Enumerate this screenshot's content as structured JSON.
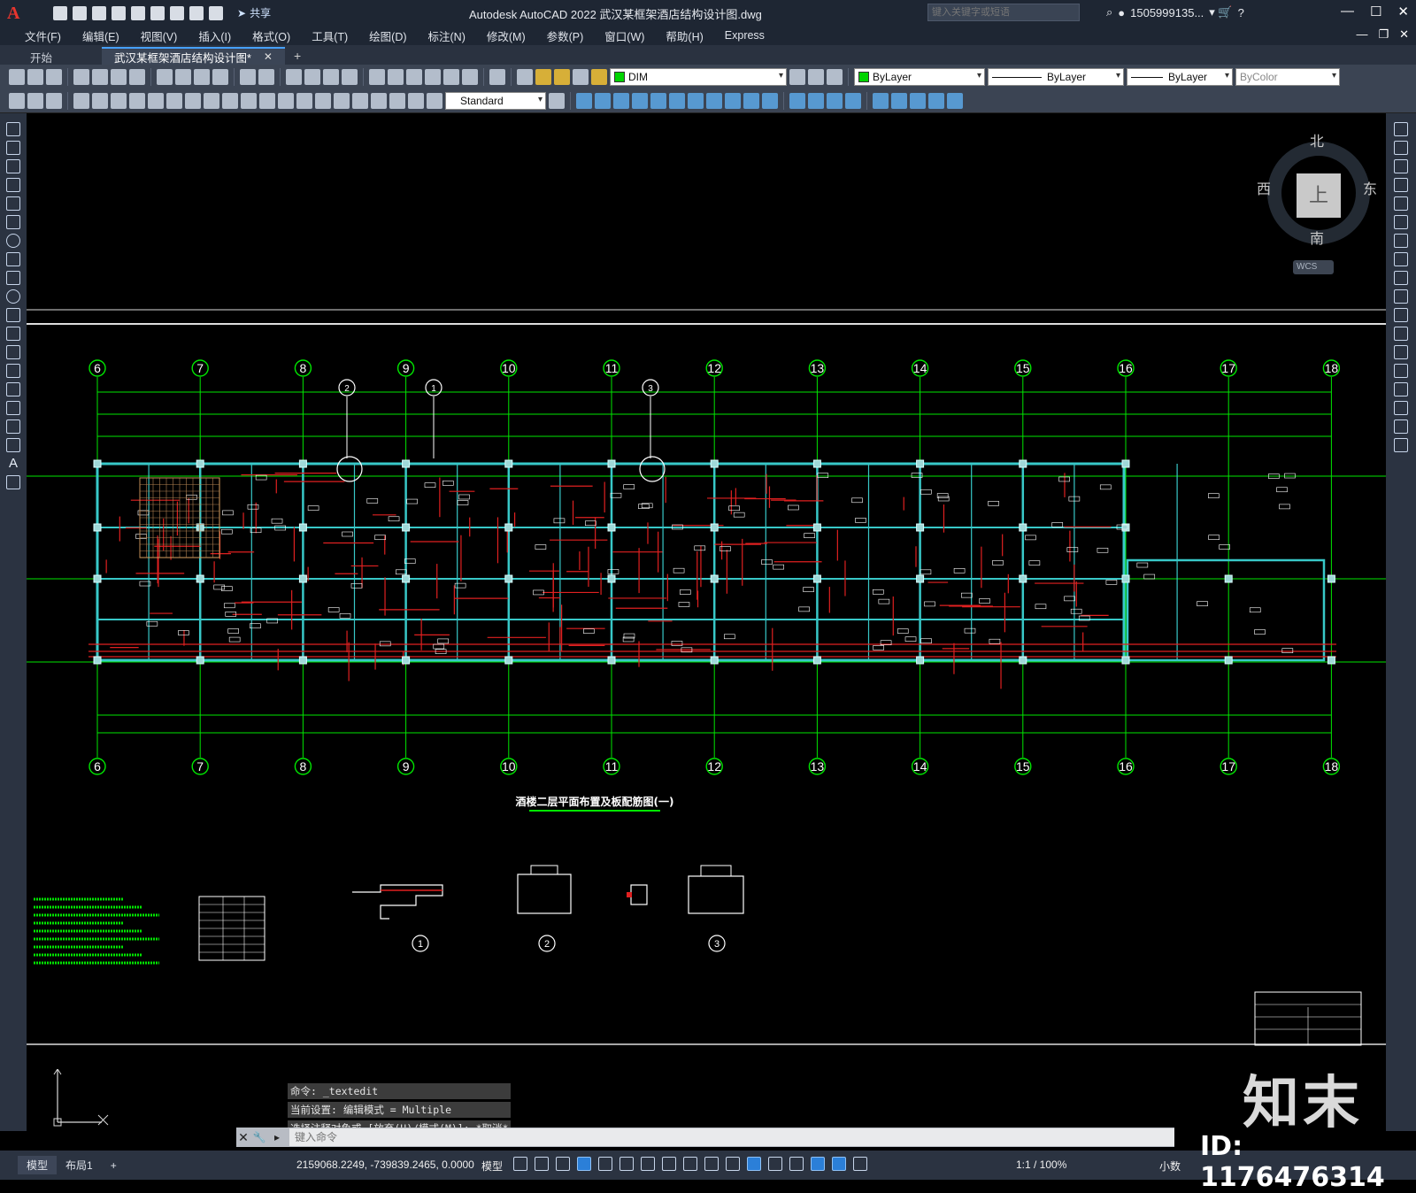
{
  "app": {
    "logo": "A",
    "title": "Autodesk AutoCAD 2022    武汉某框架酒店结构设计图.dwg",
    "share_label": "共享",
    "search_placeholder": "键入关键字或短语",
    "user": "1505999135...",
    "window_controls": [
      "—",
      "☐",
      "✕"
    ]
  },
  "menu": [
    "文件(F)",
    "编辑(E)",
    "视图(V)",
    "插入(I)",
    "格式(O)",
    "工具(T)",
    "绘图(D)",
    "标注(N)",
    "修改(M)",
    "参数(P)",
    "窗口(W)",
    "帮助(H)",
    "Express"
  ],
  "tabs": {
    "start": "开始",
    "active": "武汉某框架酒店结构设计图*",
    "close": "✕",
    "add": "+"
  },
  "toolbar": {
    "layer": "DIM",
    "color": "ByLayer",
    "linetype": "ByLayer",
    "lineweight": "ByLayer",
    "plotstyle": "ByColor",
    "textstyle": "Standard",
    "layer_color": "#00d400"
  },
  "viewcube": {
    "north": "北",
    "south": "南",
    "west": "西",
    "east": "东",
    "top": "上",
    "wcs": "WCS"
  },
  "drawing": {
    "grid_labels": [
      "6",
      "7",
      "8",
      "9",
      "10",
      "11",
      "12",
      "13",
      "14",
      "15",
      "16",
      "17",
      "18"
    ],
    "section_markers": [
      "2",
      "1",
      "3"
    ],
    "plan_title": "酒楼二层平面布置及板配筋图(一)",
    "detail_labels": [
      "1",
      "2",
      "3"
    ],
    "colors": {
      "grid": "#00e600",
      "beam": "#e02020",
      "column": "#7fd0d0",
      "text": "#ffffff",
      "cyan": "#38c8c8"
    }
  },
  "command": {
    "history": [
      "命令: _textedit",
      "当前设置: 编辑模式 = Multiple",
      "选择注释对象或 [放弃(U)/模式(M)]: *取消*"
    ],
    "placeholder": "键入命令"
  },
  "status": {
    "model_tab": "模型",
    "layout_tab": "布局1",
    "add": "+",
    "coordinates": "2159068.2249, -739839.2465, 0.0000",
    "model_label": "模型",
    "scale": "1:1 / 100%",
    "units": "小数"
  },
  "watermark": {
    "logo": "知末",
    "id": "ID: 1176476314"
  }
}
